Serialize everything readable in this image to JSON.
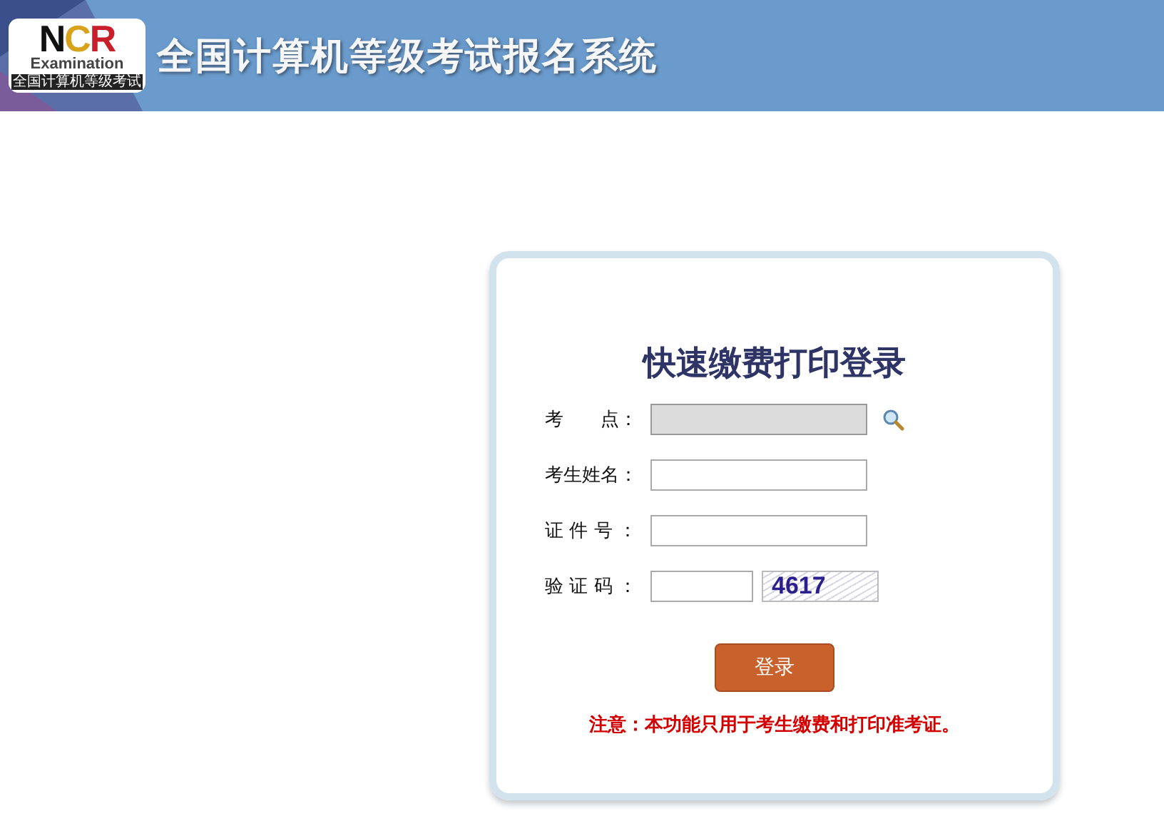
{
  "header": {
    "logo": {
      "letters": "NCR",
      "word": "Examination",
      "strip": "全国计算机等级考试"
    },
    "title": "全国计算机等级考试报名系统"
  },
  "login": {
    "title": "快速缴费打印登录",
    "fields": [
      {
        "kind": "lookup",
        "label": "考　　点：",
        "disabled": true
      },
      {
        "kind": "text",
        "label": "考生姓名：",
        "disabled": false
      },
      {
        "kind": "text",
        "label": "证 件 号 ：",
        "disabled": false
      },
      {
        "kind": "captcha",
        "label": "验 证 码 ：",
        "disabled": false,
        "captcha": "4617"
      }
    ],
    "button": "登录",
    "note": "注意：本功能只用于考生缴费和打印准考证。"
  }
}
